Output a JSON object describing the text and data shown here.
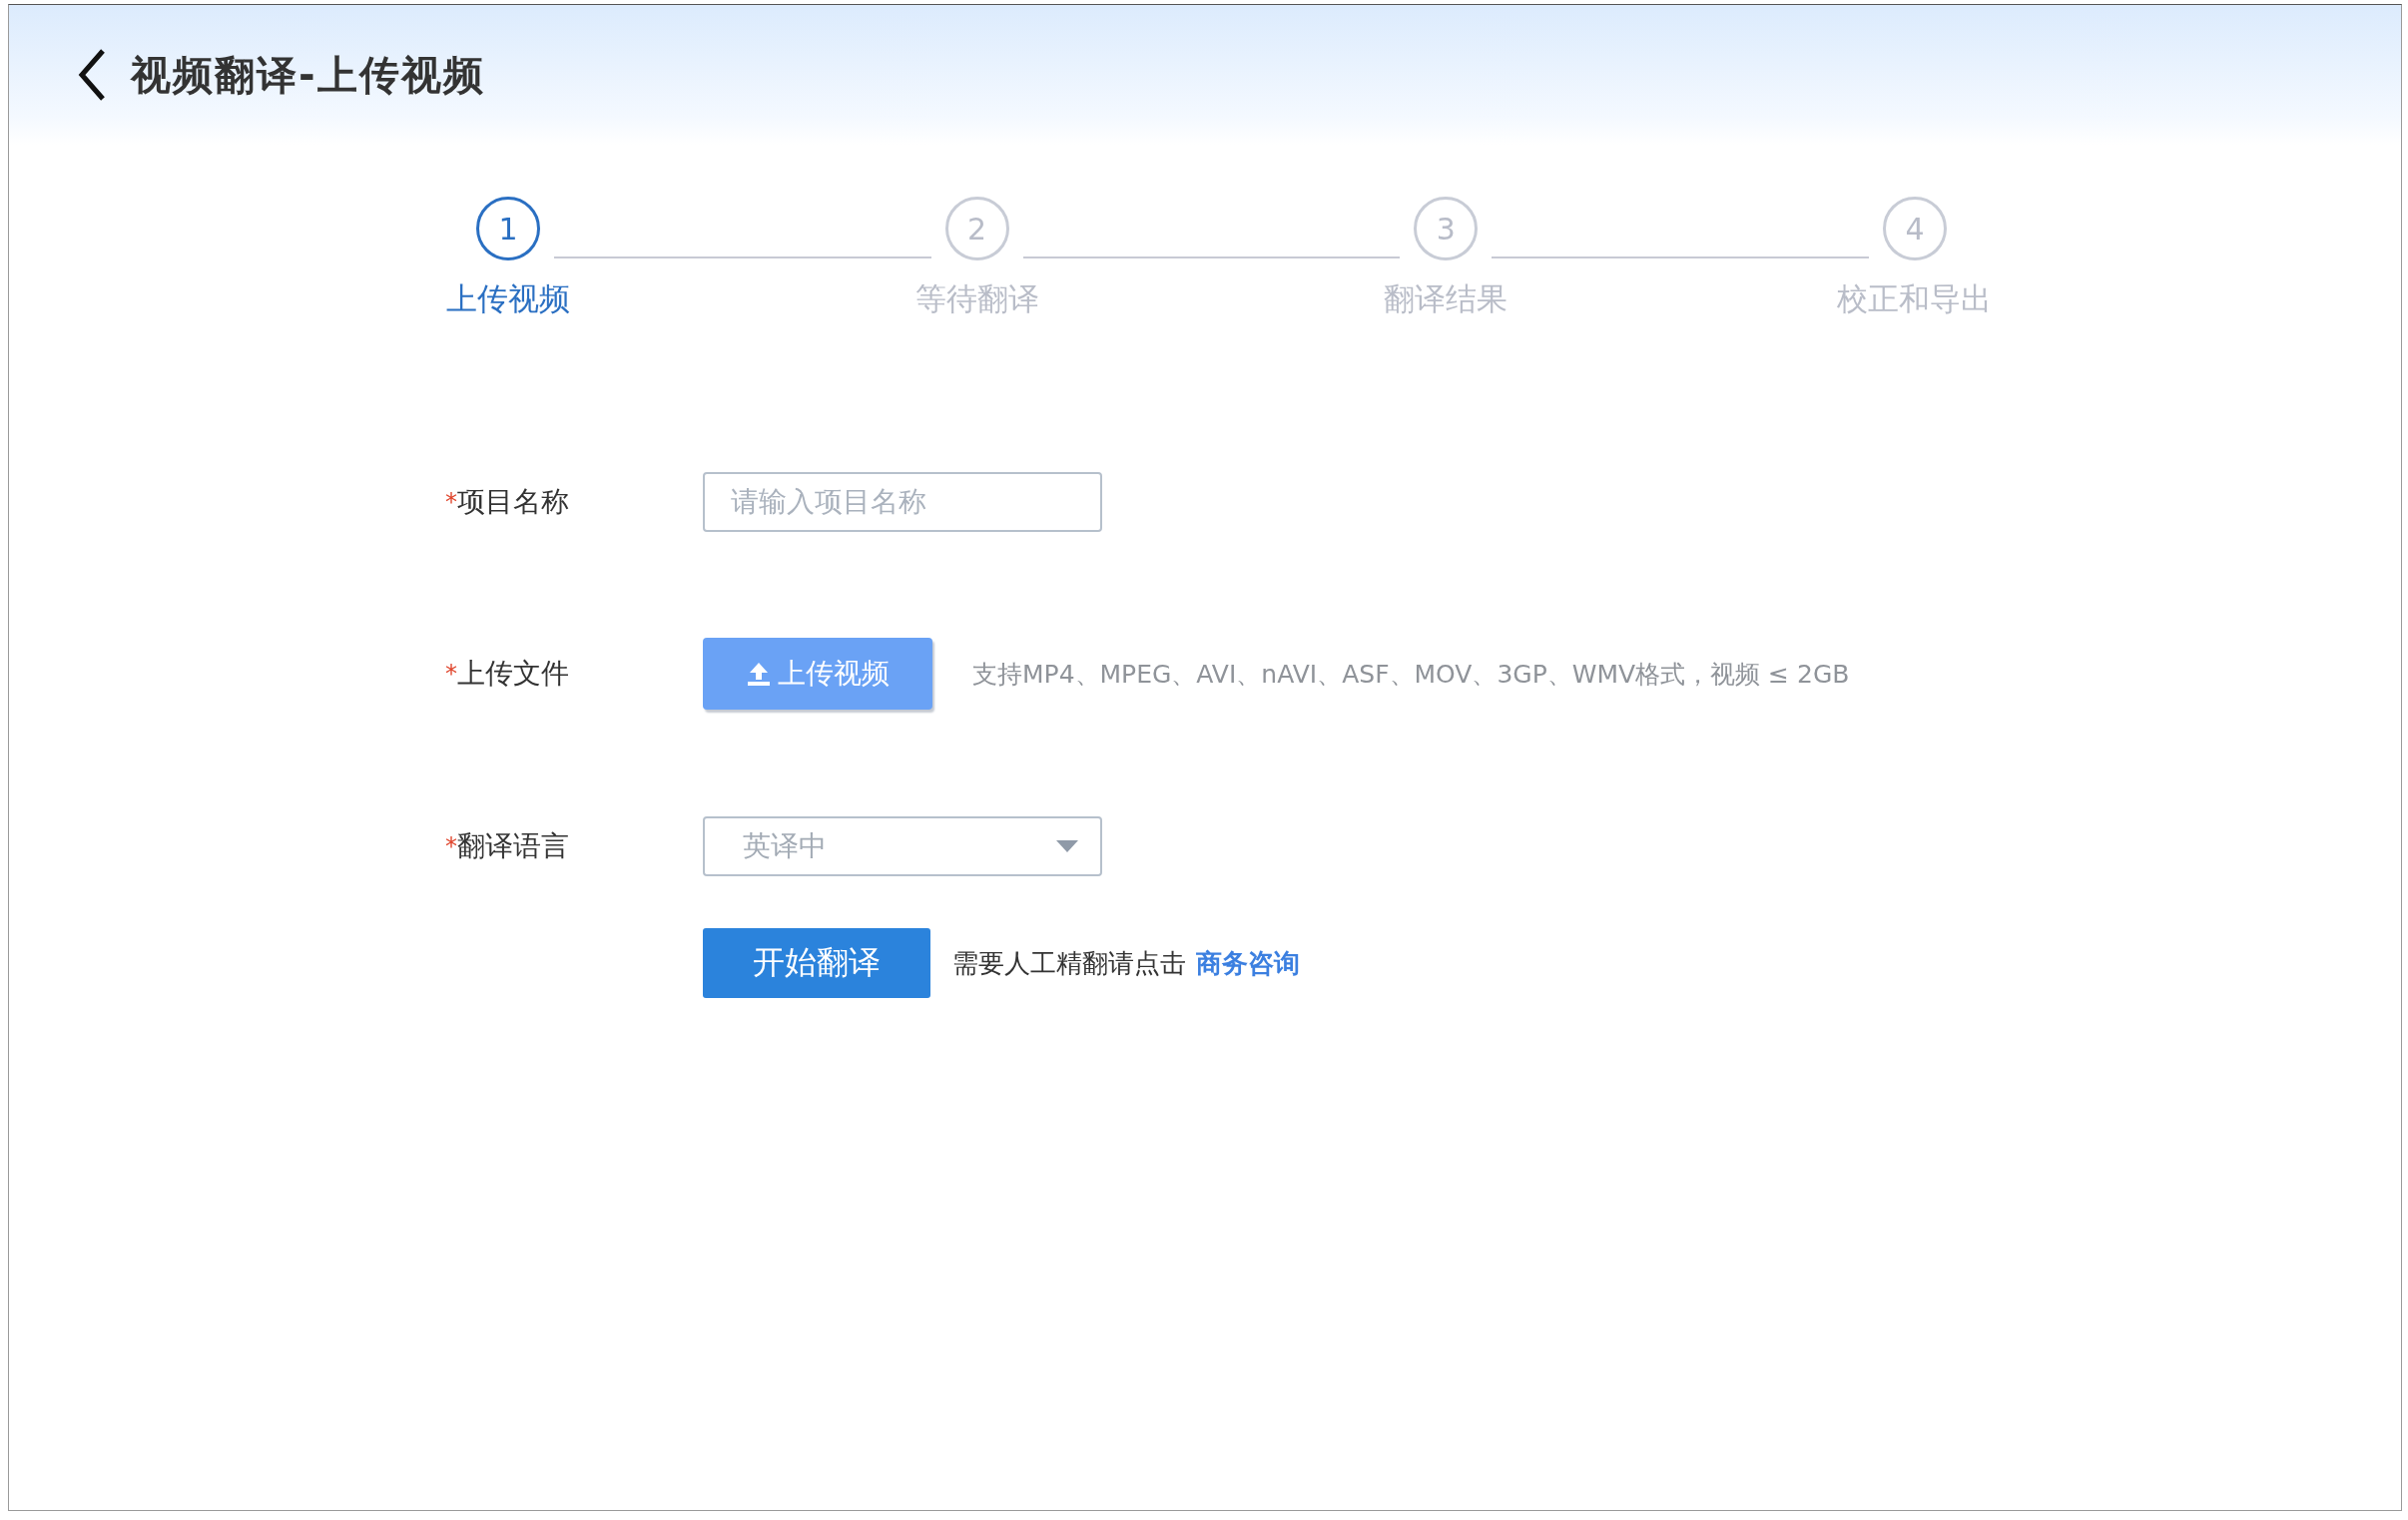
{
  "header": {
    "title": "视频翻译-上传视频"
  },
  "steps": [
    {
      "number": "1",
      "label": "上传视频",
      "selected": true
    },
    {
      "number": "2",
      "label": "等待翻译",
      "selected": false
    },
    {
      "number": "3",
      "label": "翻译结果",
      "selected": false
    },
    {
      "number": "4",
      "label": "校正和导出",
      "selected": false
    }
  ],
  "form": {
    "rows": [
      {
        "kind": "input",
        "marker": "*",
        "label": "项目名称",
        "placeholder": "请输入项目名称"
      },
      {
        "kind": "upload",
        "marker": "*",
        "label": "上传文件",
        "button": "上传视频",
        "hint": "支持MP4、MPEG、AVI、nAVI、ASF、MOV、3GP、WMV格式，视频 ≤ 2GB"
      },
      {
        "kind": "select",
        "marker": "*",
        "label": "翻译语言",
        "value": "英译中"
      }
    ],
    "submit": {
      "button": "开始翻译",
      "note": "需要人工精翻请点击",
      "link": "商务咨询"
    }
  }
}
